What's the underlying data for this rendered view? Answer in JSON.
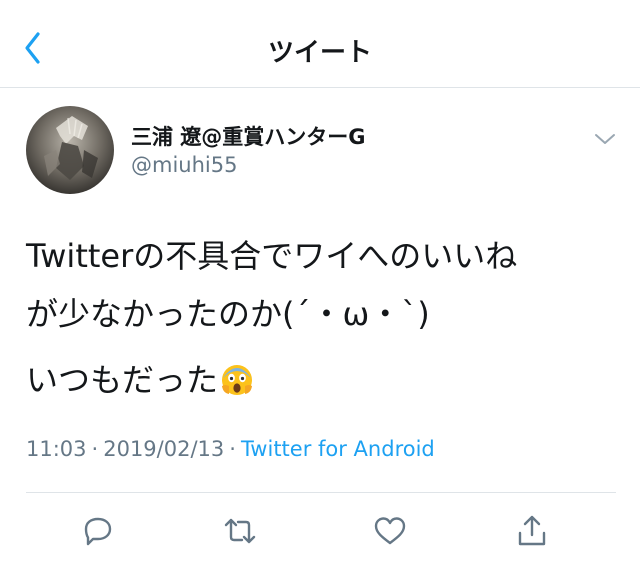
{
  "nav": {
    "title": "ツイート",
    "back_icon": "chevron-left-icon"
  },
  "tweet": {
    "author": {
      "display_name": "三浦 遼@重賞ハンターG",
      "handle": "@miuhi55"
    },
    "text": {
      "line1": "Twitterの不具合でワイへのいいね",
      "line2": "が少なかったのか(´・ω・`)",
      "line3": "いつもだった",
      "line3_emoji": "face-screaming-in-fear"
    },
    "meta": {
      "time": "11:03",
      "separator": "·",
      "date": "2019/02/13",
      "source": "Twitter for Android"
    },
    "actions": {
      "reply_icon": "reply-icon",
      "retweet_icon": "retweet-icon",
      "like_icon": "heart-icon",
      "share_icon": "share-icon"
    }
  },
  "colors": {
    "accent": "#1da1f2",
    "text": "#14171a",
    "secondary": "#657786",
    "divider": "#dfe4e8"
  }
}
